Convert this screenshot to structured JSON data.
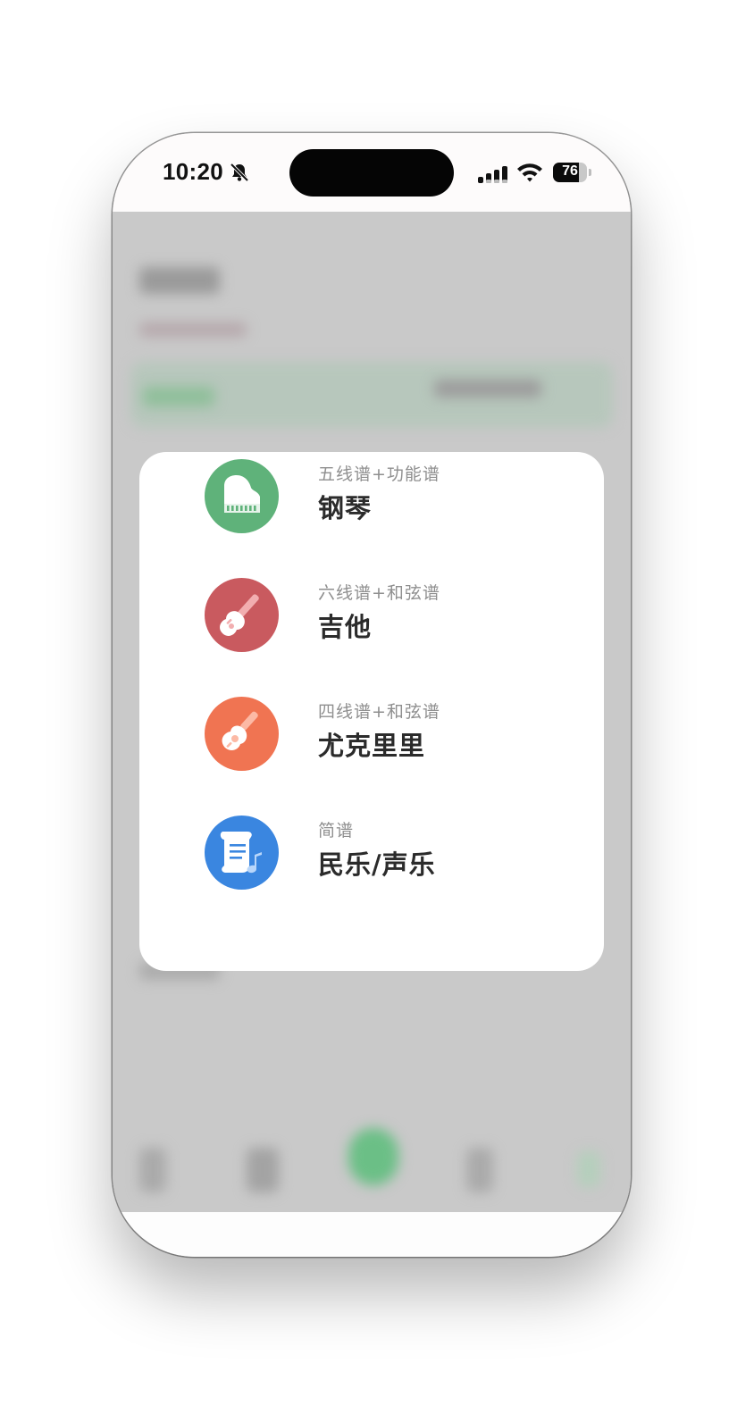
{
  "status_bar": {
    "time": "10:20",
    "battery_percent": "76",
    "battery_level": 0.76,
    "icons": [
      "bell-slash-icon",
      "cellular-signal-icon",
      "wifi-icon",
      "battery-icon"
    ]
  },
  "instrument_picker": {
    "items": [
      {
        "subtitle": "五线谱+功能谱",
        "title": "钢琴",
        "icon": "piano-icon",
        "color": "#5fb27a"
      },
      {
        "subtitle": "六线谱+和弦谱",
        "title": "吉他",
        "icon": "electric-guitar-icon",
        "color": "#c95a5f"
      },
      {
        "subtitle": "四线谱+和弦谱",
        "title": "尤克里里",
        "icon": "ukulele-icon",
        "color": "#f07452"
      },
      {
        "subtitle": "简谱",
        "title": "民乐/声乐",
        "icon": "music-scroll-icon",
        "color": "#3a86e0"
      }
    ]
  }
}
